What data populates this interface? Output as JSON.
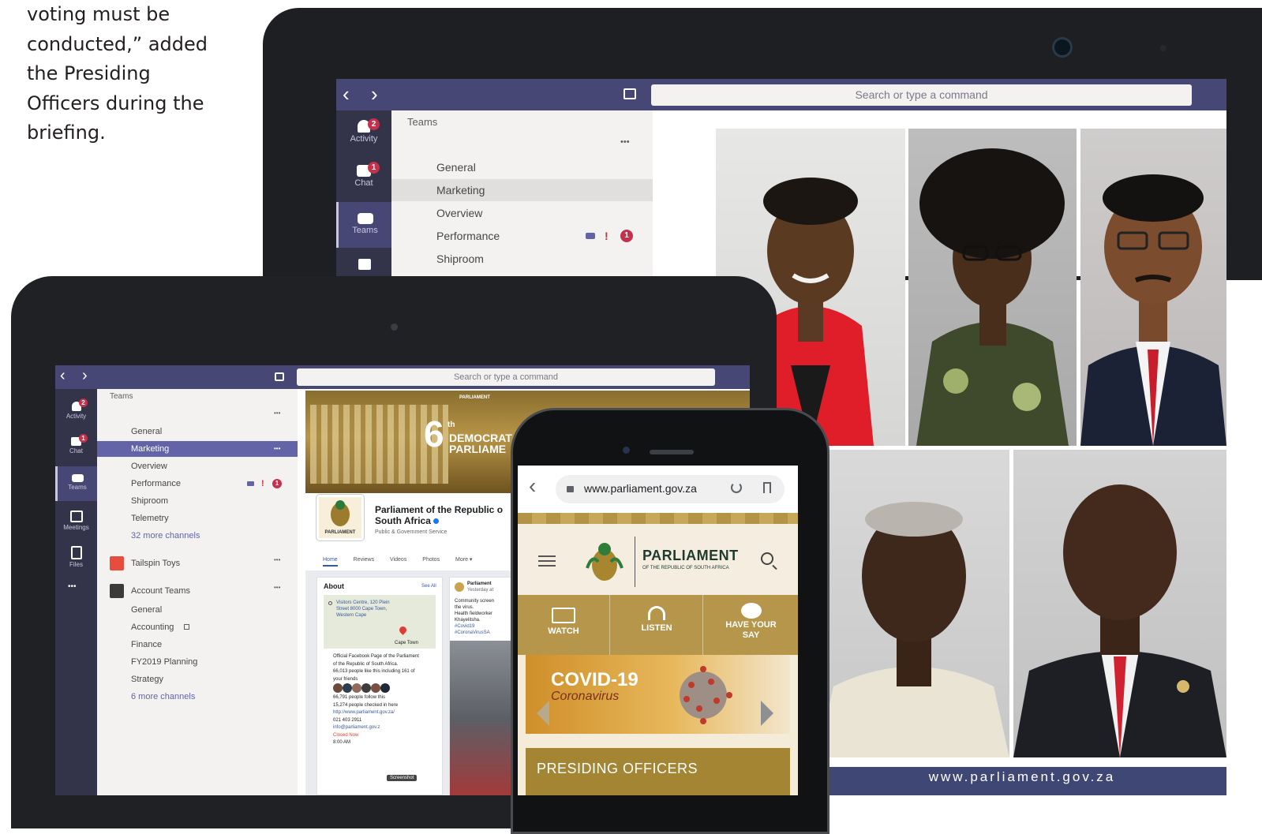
{
  "article": {
    "lines": [
      "voting must be",
      "conducted,” added",
      "the Presiding",
      "Officers during the",
      "briefing."
    ]
  },
  "teams_back": {
    "search_placeholder": "Search or type a command",
    "header": "Teams",
    "rail": [
      {
        "label": "Activity",
        "badge": "2",
        "icon": "bell-icon"
      },
      {
        "label": "Chat",
        "badge": "1",
        "icon": "chat-icon"
      },
      {
        "label": "Teams",
        "badge": "",
        "icon": "teams-icon"
      }
    ],
    "more": "•••",
    "channels": [
      "General",
      "Marketing",
      "Overview",
      "Performance",
      "Shiproom"
    ],
    "perf_alert": "!",
    "perf_badge": "1"
  },
  "teams_front": {
    "search_placeholder": "Search or type a command",
    "header": "Teams",
    "rail": [
      {
        "label": "Activity",
        "badge": "2",
        "icon": "bell-icon"
      },
      {
        "label": "Chat",
        "badge": "1",
        "icon": "chat-icon"
      },
      {
        "label": "Teams",
        "badge": "",
        "icon": "teams-icon"
      },
      {
        "label": "Meetings",
        "badge": "",
        "icon": "calendar-icon"
      },
      {
        "label": "Files",
        "badge": "",
        "icon": "file-icon"
      }
    ],
    "more": "•••",
    "channels": [
      "General",
      "Marketing",
      "Overview",
      "Performance",
      "Shiproom",
      "Telemetry"
    ],
    "more_channels": "32 more channels",
    "perf_alert": "!",
    "perf_badge": "1",
    "team2": "Tailspin Toys",
    "team3": "Account Teams",
    "team3_channels": [
      "General",
      "Accounting",
      "Finance",
      "FY2019 Planning",
      "Strategy"
    ],
    "team3_more": "6 more channels"
  },
  "facebook": {
    "cover_big": "6",
    "cover_sup": "th",
    "cover_line1": "DEMOCRAT",
    "cover_line2": "PARLIAME",
    "cover_tag": "PARLIAMENT",
    "page_name_1": "Parliament of the Republic o",
    "page_name_2": "South Africa",
    "category": "Public & Government Service",
    "logo_caption": "PARLIAMENT",
    "tabs": [
      "Home",
      "Reviews",
      "Videos",
      "Photos",
      "More ▾"
    ],
    "about_title": "About",
    "see_all": "See All",
    "map_address_1": "Visitors Centre, 120 Plein",
    "map_address_2": "Street 8000 Cape Town,",
    "map_address_3": "Western Cape",
    "map_label": "Cape Town",
    "about_items": [
      "Official Facebook Page of the Parliament",
      "of the Republic of South Africa.",
      "66,013 people like this including 161 of",
      "your friends",
      "66,791 people follow this",
      "15,274 people checked in here",
      "http://www.parliament.gov.za/",
      "021 403 2911",
      "info@parliament.gov.z",
      "Closed Now",
      "8:00 AM"
    ],
    "screenshot_tip": "Screenshot",
    "post_author": "Parliament",
    "post_time": "Yesterday at",
    "post_lines": [
      "Community screen",
      "the virus.",
      "Health fieldworker",
      "Khayelitsha.",
      "#Covid19",
      "#CoronaVirusSA"
    ]
  },
  "phone": {
    "url": "www.parliament.gov.za",
    "brand": "PARLIAMENT",
    "brand_sub": "OF THE REPUBLIC OF SOUTH AFRICA",
    "nav": [
      "WATCH",
      "LISTEN",
      "HAVE YOUR SAY"
    ],
    "covid_title": "COVID-19",
    "covid_sub": "Coronavirus",
    "section": "PRESIDING OFFICERS"
  },
  "collage": {
    "footer": "www.parliament.gov.za"
  },
  "colors": {
    "teams_purple": "#464775",
    "teams_rail": "#33344a",
    "alert_red": "#c4314b",
    "parliament_gold": "#b6964a",
    "covid_orange": "#cf8f2a",
    "fb_blue": "#385898"
  }
}
